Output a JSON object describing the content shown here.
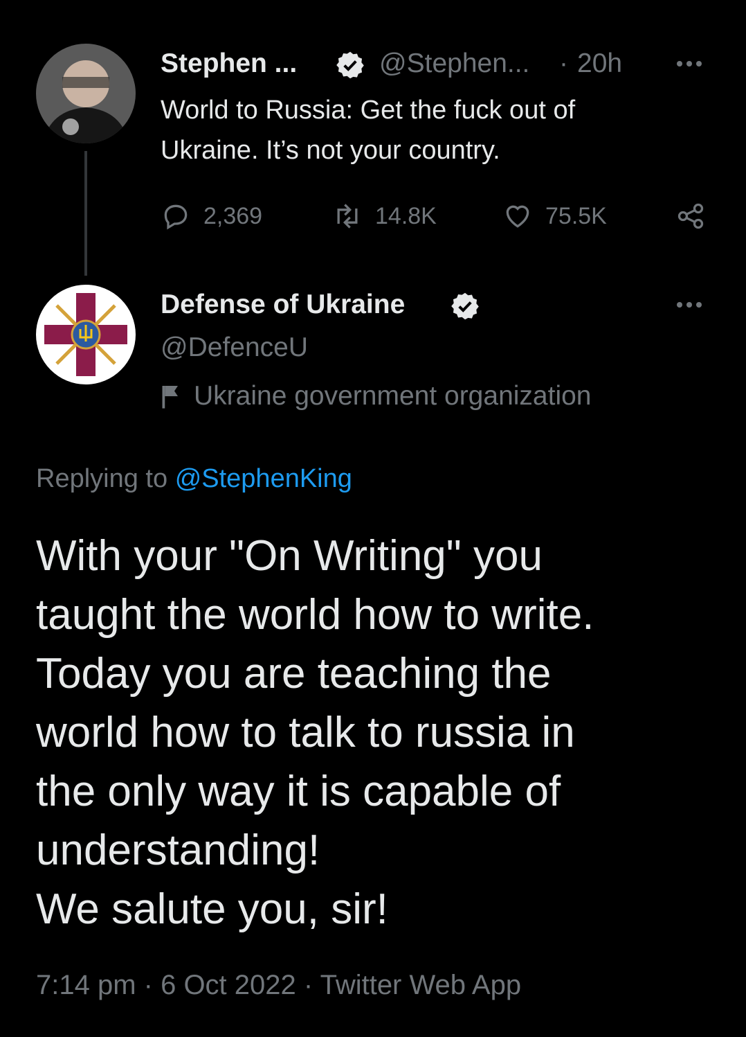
{
  "parent_tweet": {
    "display_name": "Stephen ...",
    "handle": "@Stephen...",
    "separator": "·",
    "time": "20h",
    "text_line1": "World to Russia: Get the fuck out of",
    "text_line2": "Ukraine. It’s not your country.",
    "replies": "2,369",
    "retweets": "14.8K",
    "likes": "75.5K"
  },
  "main_tweet": {
    "display_name": "Defense of Ukraine",
    "handle": "@DefenceU",
    "affiliation": "Ukraine government organization",
    "replying_prefix": "Replying to",
    "replying_handle": "@StephenKing",
    "text": "With your \"On Writing\" you\ntaught the world how to write.\nToday you are teaching the\nworld how to talk to russia in\nthe only way it is capable of\nunderstanding!\nWe salute you, sir!",
    "meta": "7:14 pm · 6 Oct 2022 · Twitter Web App"
  },
  "icons": [
    "verified-badge-icon",
    "reply-icon",
    "retweet-icon",
    "like-icon",
    "share-icon",
    "more-icon",
    "government-flag-icon"
  ],
  "colors": {
    "background": "#000000",
    "text": "#e7e9ea",
    "muted": "#71767b",
    "link": "#1d9bf0",
    "verified": "#e7e9ea"
  }
}
